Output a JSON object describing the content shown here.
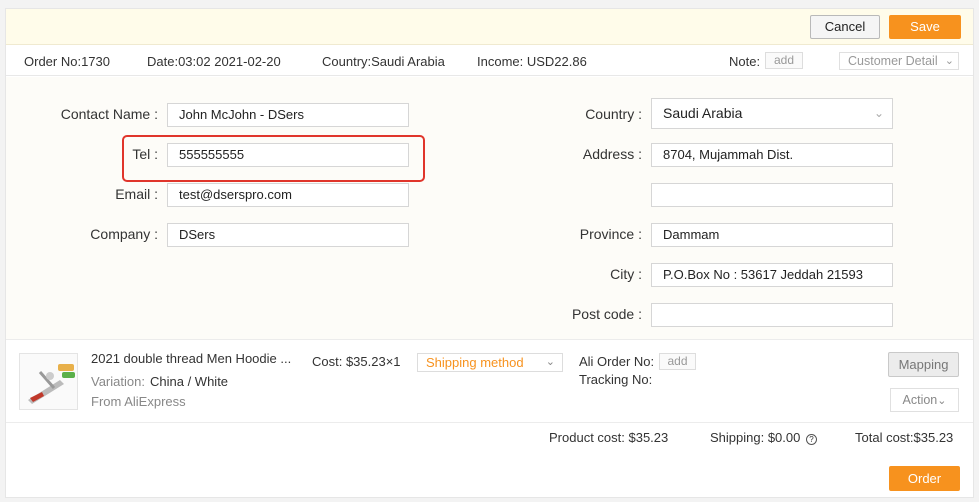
{
  "toolbar": {
    "cancel_label": "Cancel",
    "save_label": "Save"
  },
  "info": {
    "order_no": "Order No:1730",
    "date": "Date:03:02 2021-02-20",
    "country": "Country:Saudi Arabia",
    "income": "Income: USD22.86",
    "note_label": "Note:",
    "note_add": "add",
    "customer_detail": "Customer Detail"
  },
  "form": {
    "contact_name": {
      "label": "Contact Name",
      "value": "John McJohn - DSers"
    },
    "tel": {
      "label": "Tel",
      "value": "555555555"
    },
    "email": {
      "label": "Email",
      "value": "test@dserspro.com"
    },
    "company": {
      "label": "Company",
      "value": "DSers"
    },
    "country": {
      "label": "Country",
      "value": "Saudi Arabia"
    },
    "address": {
      "label": "Address",
      "value": "8704, Mujammah Dist.",
      "value2": ""
    },
    "province": {
      "label": "Province",
      "value": "Dammam"
    },
    "city": {
      "label": "City",
      "value": "P.O.Box No : 53617 Jeddah 21593"
    },
    "post_code": {
      "label": "Post code",
      "value": ""
    }
  },
  "product": {
    "title": "2021 double thread Men Hoodie ...",
    "variation_label": "Variation:",
    "variation_value": "China / White",
    "source": "From AliExpress",
    "cost": "Cost: $35.23×1",
    "shipping_method": "Shipping method",
    "ali_order_label": "Ali Order No:",
    "ali_order_add": "add",
    "tracking_label": "Tracking No:",
    "mapping_label": "Mapping",
    "action_label": "Action"
  },
  "totals": {
    "product_cost": "Product cost: $35.23",
    "shipping": "Shipping: $0.00",
    "total_cost": "Total cost:$35.23"
  },
  "order_label": "Order",
  "colors": {
    "accent": "#f7921e",
    "highlight": "#e0352b",
    "topbar": "#fffcea"
  },
  "icons": {
    "chevron": "chevron-down-icon",
    "help": "question-circle-icon"
  }
}
